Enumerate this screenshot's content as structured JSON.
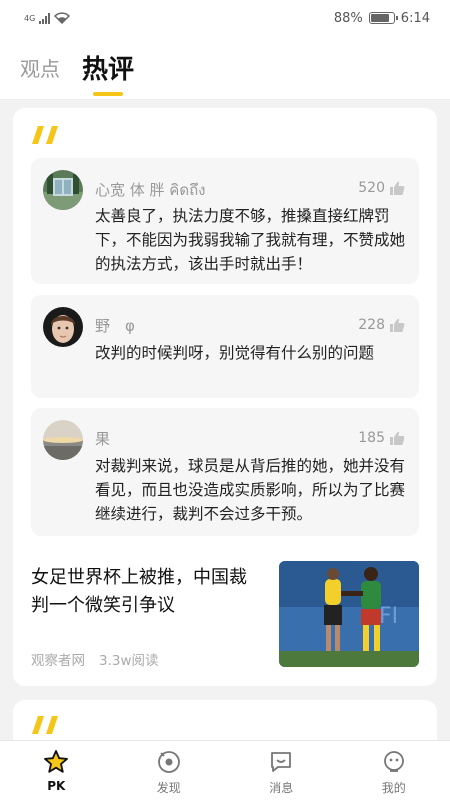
{
  "status_bar": {
    "network": "4G",
    "battery_text": "88%",
    "battery_level": 0.88,
    "time": "6:14"
  },
  "header": {
    "tabs": [
      {
        "label": "观点",
        "active": false
      },
      {
        "label": "热评",
        "active": true
      }
    ]
  },
  "feed": {
    "comments": [
      {
        "name": "心宽 体 胖 คิดถึง",
        "likes": "520",
        "text": "太善良了，执法力度不够，推搡直接红牌罚下，不能因为我弱我输了我就有理，不赞成她的执法方式，该出手时就出手！"
      },
      {
        "name": "野　φ",
        "likes": "228",
        "text": "改判的时候判呀，别觉得有什么别的问题"
      },
      {
        "name": "果",
        "likes": "185",
        "text": "对裁判来说，球员是从背后推的她，她并没有看见，而且也没造成实质影响，所以为了比赛继续进行，裁判不会过多干预。"
      }
    ],
    "article": {
      "title": "女足世界杯上被推，中国裁判一个微笑引争议",
      "source": "观察者网",
      "reads": "3.3w阅读"
    }
  },
  "tab_bar": {
    "items": [
      {
        "label": "PK",
        "icon": "star-icon",
        "active": true
      },
      {
        "label": "发现",
        "icon": "compass-icon",
        "active": false
      },
      {
        "label": "消息",
        "icon": "message-icon",
        "active": false
      },
      {
        "label": "我的",
        "icon": "profile-icon",
        "active": false
      }
    ]
  },
  "colors": {
    "accent": "#f5c518",
    "background": "#f2f2f2",
    "card": "#ffffff",
    "comment_bg": "#f6f6f6"
  }
}
